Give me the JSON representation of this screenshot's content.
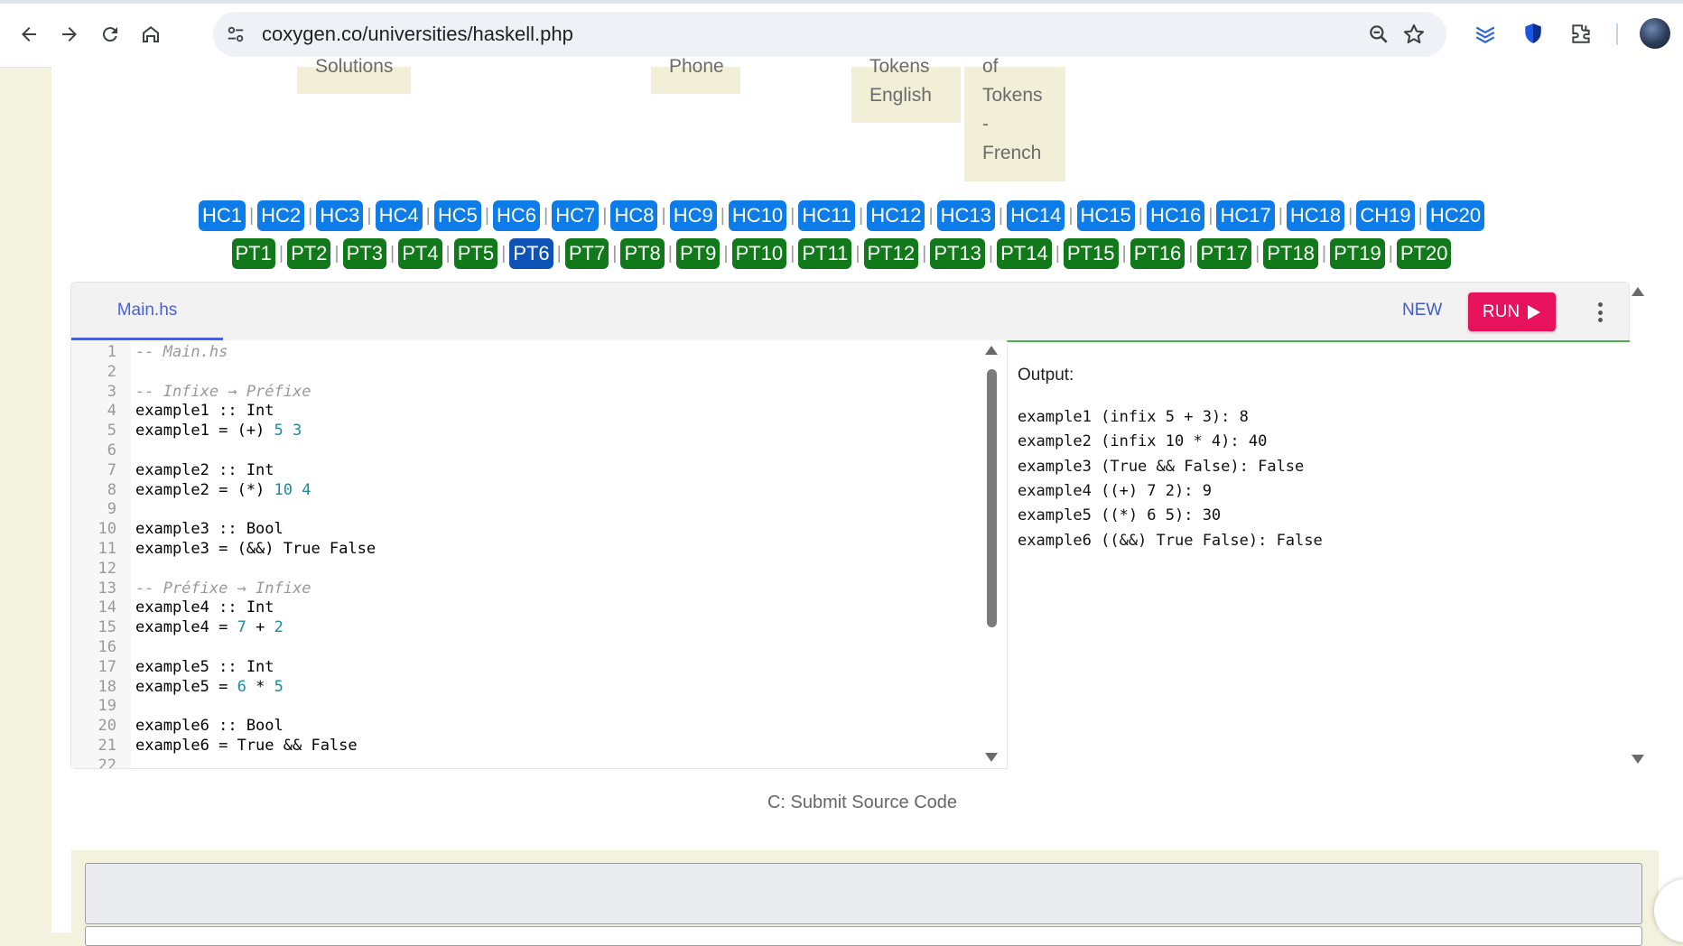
{
  "browser": {
    "url": "coxygen.co/universities/haskell.php"
  },
  "top_cards": [
    {
      "lines": [
        "Solutions"
      ]
    },
    {
      "lines": [
        "Phone"
      ]
    },
    {
      "lines": [
        "Tokens",
        "English"
      ]
    },
    {
      "lines": [
        "of",
        "Tokens",
        "-",
        "French"
      ]
    }
  ],
  "nav": {
    "hc_links": [
      "HC1",
      "HC2",
      "HC3",
      "HC4",
      "HC5",
      "HC6",
      "HC7",
      "HC8",
      "HC9",
      "HC10",
      "HC11",
      "HC12",
      "HC13",
      "HC14",
      "HC15",
      "HC16",
      "HC17",
      "HC18",
      "CH19",
      "HC20"
    ],
    "pt_links": [
      "PT1",
      "PT2",
      "PT3",
      "PT4",
      "PT5",
      "PT6",
      "PT7",
      "PT8",
      "PT9",
      "PT10",
      "PT11",
      "PT12",
      "PT13",
      "PT14",
      "PT15",
      "PT16",
      "PT17",
      "PT18",
      "PT19",
      "PT20"
    ],
    "pt_active": "PT6",
    "separator": "|"
  },
  "editor": {
    "file_tab": "Main.hs",
    "new_label": "NEW",
    "run_label": "RUN",
    "code_lines": [
      "-- Main.hs",
      "",
      "-- Infixe → Préfixe",
      "example1 :: Int",
      "example1 = (+) 5 3",
      "",
      "example2 :: Int",
      "example2 = (*) 10 4",
      "",
      "example3 :: Bool",
      "example3 = (&&) True False",
      "",
      "-- Préfixe → Infixe",
      "example4 :: Int",
      "example4 = 7 + 2",
      "",
      "example5 :: Int",
      "example5 = 6 * 5",
      "",
      "example6 :: Bool",
      "example6 = True && False",
      ""
    ],
    "output_label": "Output:",
    "output_lines": [
      "example1 (infix 5 + 3): 8",
      "example2 (infix 10 * 4): 40",
      "example3 (True && False): False",
      "example4 ((+) 7 2): 9",
      "example5 ((*) 6 5): 30",
      "example6 ((&&) True False): False"
    ]
  },
  "submit": {
    "title": "C: Submit Source Code"
  },
  "colors": {
    "hc_button": "#0d7be8",
    "pt_button": "#12791b",
    "pt_active": "#0f52b6",
    "run_button": "#e8115c",
    "accent_tab": "#4b62d6",
    "page_bg": "#f3f2de"
  },
  "icons": [
    "back-arrow-icon",
    "forward-arrow-icon",
    "reload-icon",
    "home-icon",
    "site-settings-icon",
    "zoom-icon",
    "star-icon",
    "layers-extension-icon",
    "shield-extension-icon",
    "puzzle-extensions-icon",
    "play-icon",
    "kebab-menu-icon"
  ]
}
